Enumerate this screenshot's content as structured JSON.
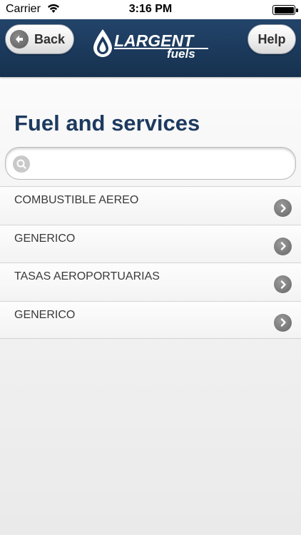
{
  "status_bar": {
    "carrier": "Carrier",
    "time": "3:16 PM"
  },
  "nav": {
    "back_label": "Back",
    "help_label": "Help",
    "logo_name": "LARGENT",
    "logo_sub": "fuels",
    "bar_color": "#1c3a5d"
  },
  "page": {
    "title": "Fuel and services"
  },
  "search": {
    "value": "",
    "placeholder": ""
  },
  "list": {
    "items": [
      {
        "label": "COMBUSTIBLE AEREO"
      },
      {
        "label": "GENERICO"
      },
      {
        "label": "TASAS AEROPORTUARIAS"
      },
      {
        "label": "GENERICO"
      }
    ]
  }
}
